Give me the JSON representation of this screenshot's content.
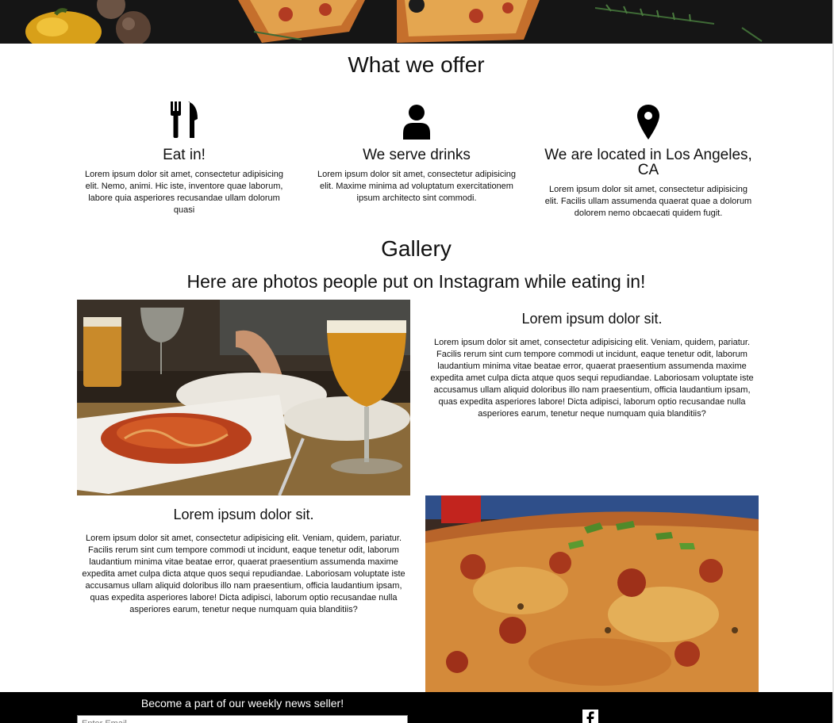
{
  "offer": {
    "title": "What we offer",
    "items": [
      {
        "icon": "utensils-icon",
        "title": "Eat in!",
        "text": "Lorem ipsum dolor sit amet, consectetur adipisicing elit. Nemo, animi. Hic iste, inventore quae laborum, labore quia asperiores recusandae ullam dolorum quasi"
      },
      {
        "icon": "user-icon",
        "title": "We serve drinks",
        "text": "Lorem ipsum dolor sit amet, consectetur adipisicing elit. Maxime minima ad voluptatum exercitationem ipsum architecto sint commodi."
      },
      {
        "icon": "map-marker-icon",
        "title": "We are located in Los Angeles, CA",
        "text": "Lorem ipsum dolor sit amet, consectetur adipisicing elit. Facilis ullam assumenda quaerat quae a dolorum dolorem nemo obcaecati quidem fugit."
      }
    ]
  },
  "gallery": {
    "title": "Gallery",
    "subtitle": "Here are photos people put on Instagram while eating in!",
    "blocks": [
      {
        "heading": "Lorem ipsum dolor sit.",
        "text": "Lorem ipsum dolor sit amet, consectetur adipisicing elit. Veniam, quidem, pariatur. Facilis rerum sint cum tempore commodi ut incidunt, eaque tenetur odit, laborum laudantium minima vitae beatae error, quaerat praesentium assumenda maxime expedita amet culpa dicta atque quos sequi repudiandae. Laboriosam voluptate iste accusamus ullam aliquid doloribus illo nam praesentium, officia laudantium ipsam, quas expedita asperiores labore! Dicta adipisci, laborum optio recusandae nulla asperiores earum, tenetur neque numquam quia blanditiis?"
      },
      {
        "heading": "Lorem ipsum dolor sit.",
        "text": "Lorem ipsum dolor sit amet, consectetur adipisicing elit. Veniam, quidem, pariatur. Facilis rerum sint cum tempore commodi ut incidunt, eaque tenetur odit, laborum laudantium minima vitae beatae error, quaerat praesentium assumenda maxime expedita amet culpa dicta atque quos sequi repudiandae. Laboriosam voluptate iste accusamus ullam aliquid doloribus illo nam praesentium, officia laudantium ipsam, quas expedita asperiores labore! Dicta adipisci, laborum optio recusandae nulla asperiores earum, tenetur neque numquam quia blanditiis?"
      }
    ],
    "photos": [
      "pasta-dinner-photo",
      "pizza-closeup-photo"
    ]
  },
  "footer": {
    "newsletter_label": "Become a part of our weekly news seller!",
    "email_value": "Enter Email",
    "social_icon": "facebook-icon"
  },
  "colors": {
    "hero_bg": "#141414",
    "footer_bg": "#000000",
    "text": "#111111"
  }
}
